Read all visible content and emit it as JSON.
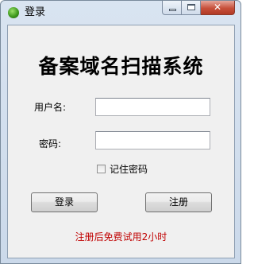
{
  "window": {
    "title": "登录",
    "controls": {
      "minimize": "minimize",
      "maximize": "maximize",
      "close": "✕"
    }
  },
  "form": {
    "heading": "备案域名扫描系统",
    "username_label": "用户名:",
    "username_value": "",
    "password_label": "密码:",
    "password_value": "",
    "remember_label": "记住密码",
    "remember_checked": false,
    "login_button": "登录",
    "register_button": "注册",
    "notice": "注册后免费试用2小时"
  },
  "colors": {
    "notice": "#c00000",
    "titlebar": "#d9e4f1",
    "close_button": "#c7503a"
  }
}
